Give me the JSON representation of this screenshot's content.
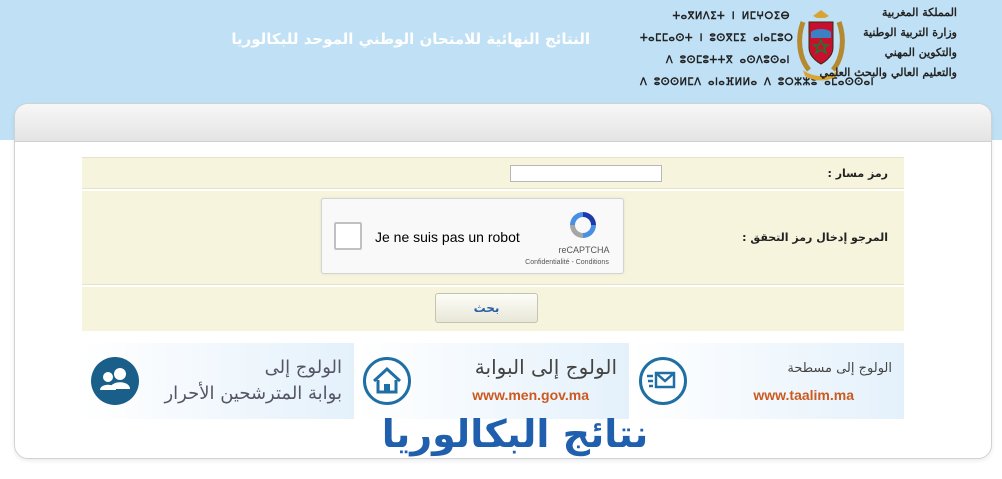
{
  "header": {
    "title": "النتائج النهائية للامتحان الوطني الموحد للبكالوريا",
    "ministry_ar": [
      "المملكة المغربية",
      "وزارة التربية الوطنية",
      "والتكوين المهني",
      "والتعليم العالي والبحث العلمي"
    ],
    "ministry_tifinagh": [
      "ⵜⴰⴳⵍⴷⵉⵜ ⵏ ⵍⵎⵖⵔⵉⴱ",
      "ⵜⴰⵎⵎⴰⵙⵜ ⵏ ⵓⵙⴳⵎⵉ ⴰⵏⴰⵎⵓⵔ",
      "ⴷ ⵓⵙⵎⵓⵜⵜⴳ ⴰⵙⴷⵓⵙⴰⵏ",
      "ⴷ ⵓⵙⵙⵍⵎⴷ ⴰⵏⴰⴼⵍⵍⴰ ⴷ ⵓⵔⵣⵣⵓ ⴰⵎⴰⵙⵙⴰⵏ"
    ]
  },
  "form": {
    "code_label": "رمز مسار :",
    "code_value": "",
    "captcha_label": "المرجو إدخال رمز التحقق :",
    "recaptcha": {
      "checkbox_label": "Je ne suis pas un robot",
      "brand": "reCAPTCHA",
      "links": "Confidentialité - Conditions"
    },
    "search_button": "بحث"
  },
  "banners": [
    {
      "line1": "الولوج إلى",
      "line2": "بوابة المترشحين الأحرار",
      "icon": "users-icon"
    },
    {
      "line1": "الولوج إلى البوابة",
      "line2": "www.men.gov.ma",
      "icon": "home-icon"
    },
    {
      "line1": "الولوج إلى مسطحة",
      "line2": "www.taalim.ma",
      "icon": "mail-icon"
    }
  ],
  "big_title": "نتائج البكالوريا",
  "colors": {
    "header_bg": "#bfe0f5",
    "form_bg": "#f6f4dd",
    "link_orange": "#cc5a1e",
    "title_blue": "#1f5fae"
  }
}
